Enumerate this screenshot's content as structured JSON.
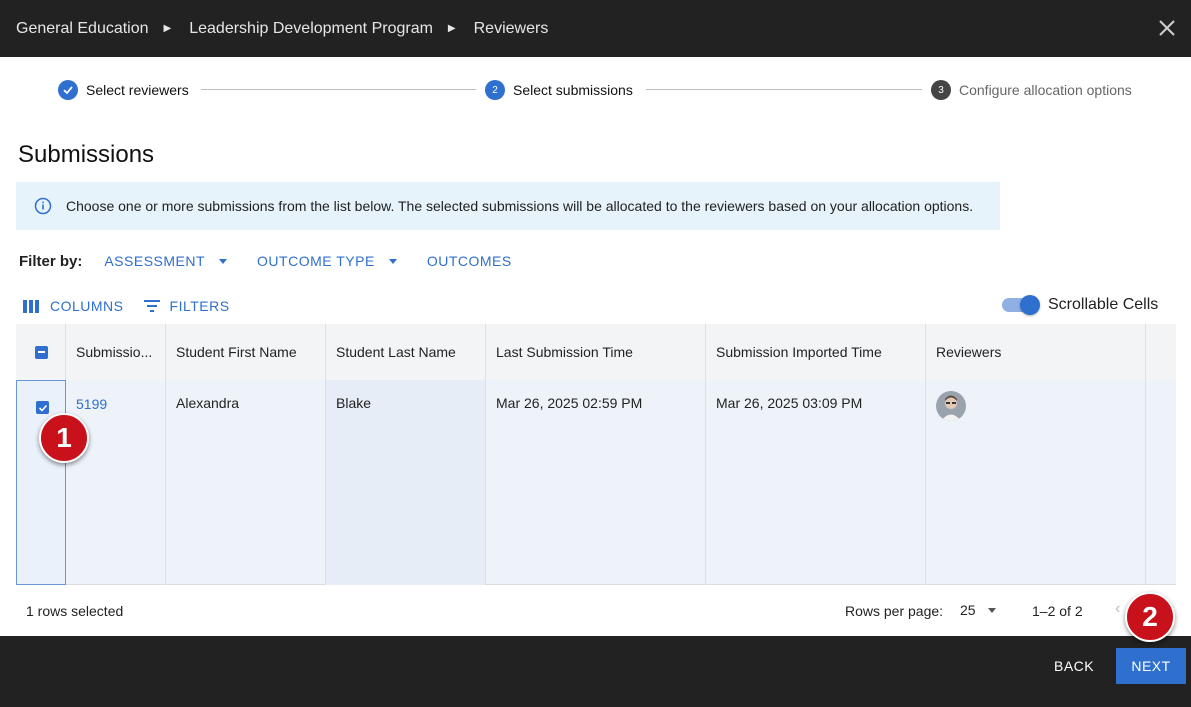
{
  "breadcrumb": {
    "items": [
      "General Education",
      "Leadership Development Program",
      "Reviewers"
    ]
  },
  "stepper": {
    "steps": [
      {
        "label": "Select reviewers",
        "number": "1",
        "state": "complete"
      },
      {
        "label": "Select submissions",
        "number": "2",
        "state": "active"
      },
      {
        "label": "Configure allocation options",
        "number": "3",
        "state": "upcoming"
      }
    ]
  },
  "page": {
    "title": "Submissions",
    "info_text": "Choose one or more submissions from the list below. The selected submissions will be allocated to the reviewers based on your allocation options."
  },
  "filters": {
    "label": "Filter by:",
    "assessment": "ASSESSMENT",
    "outcome_type": "OUTCOME TYPE",
    "outcomes": "OUTCOMES"
  },
  "toolbar": {
    "columns": "COLUMNS",
    "filters": "FILTERS",
    "scrollable_label": "Scrollable Cells",
    "scrollable_on": true
  },
  "table": {
    "headers": [
      "Submissio...",
      "Student First Name",
      "Student Last Name",
      "Last Submission Time",
      "Submission Imported Time",
      "Reviewers"
    ],
    "rows": [
      {
        "submission_id": "5199",
        "first_name": "Alexandra",
        "last_name": "Blake",
        "last_submission_time": "Mar 26, 2025 02:59 PM",
        "imported_time": "Mar 26, 2025 03:09 PM",
        "selected": true
      }
    ]
  },
  "footer": {
    "rows_selected": "1 rows selected",
    "rows_per_page_label": "Rows per page:",
    "rows_per_page_value": "25",
    "page_range": "1–2 of 2"
  },
  "actions": {
    "back": "BACK",
    "next": "NEXT"
  },
  "annotations": {
    "badge_1": "1",
    "badge_2": "2"
  },
  "colors": {
    "accent": "#2f6fce",
    "dark_bar": "#222222",
    "info_bg": "#e6f3fa",
    "badge_red": "#c8111a"
  }
}
